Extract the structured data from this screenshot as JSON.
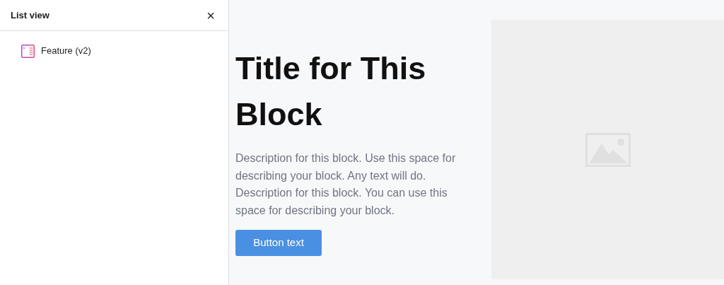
{
  "sidebar": {
    "title": "List view",
    "close": "×",
    "items": [
      {
        "label": "Feature (v2)"
      }
    ]
  },
  "block": {
    "title": "Title for This Block",
    "description": "Description for this block. Use this space for describing your block. Any text will do. Description for this block. You can use this space for describing your block.",
    "button": "Button text"
  }
}
